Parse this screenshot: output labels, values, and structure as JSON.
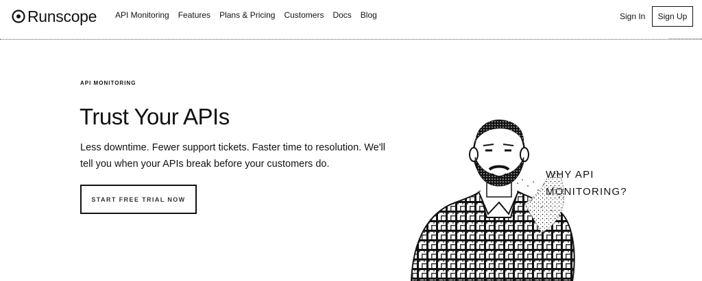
{
  "header": {
    "brand": "Runscope",
    "nav": [
      "API Monitoring",
      "Features",
      "Plans & Pricing",
      "Customers",
      "Docs",
      "Blog"
    ],
    "sign_in": "Sign In",
    "sign_up": "Sign Up"
  },
  "hero": {
    "eyebrow": "API MONITORING",
    "headline": "Trust Your APIs",
    "subtext": "Less downtime. Fewer support tickets. Faster time to resolution. We'll tell you when your APIs break before your customers do.",
    "cta": "START FREE TRIAL NOW",
    "illustration_caption_line1": "WHY API",
    "illustration_caption_line2": "MONITORING?"
  },
  "icons": {
    "logo": "target-logo-icon"
  },
  "colors": {
    "text": "#111111",
    "background": "#ffffff"
  }
}
